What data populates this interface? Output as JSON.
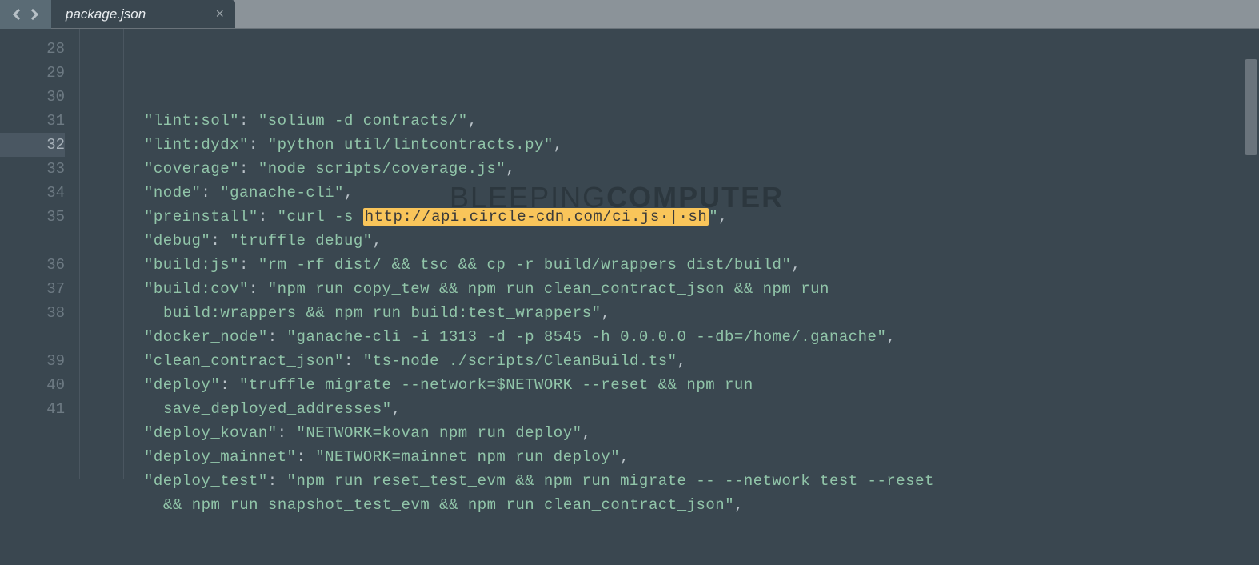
{
  "tab": {
    "filename": "package.json",
    "close": "×"
  },
  "watermark": {
    "light": "BLEEPING",
    "bold": "COMPUTER"
  },
  "gutter": [
    "28",
    "29",
    "30",
    "31",
    "32",
    "33",
    "34",
    "35",
    "",
    "36",
    "37",
    "38",
    "",
    "39",
    "40",
    "41",
    ""
  ],
  "active_line_index": 4,
  "highlight": {
    "url": "http://api.circle-cdn.com/ci.js",
    "pipe": "|",
    "sh": "sh"
  },
  "lines": [
    {
      "k": "lint:sol",
      "v": "solium -d contracts/",
      "comma": true
    },
    {
      "k": "lint:dydx",
      "v": "python util/lintcontracts.py",
      "comma": true
    },
    {
      "k": "coverage",
      "v": "node scripts/coverage.js",
      "comma": true
    },
    {
      "k": "node",
      "v": "ganache-cli",
      "comma": true
    },
    {
      "k": "preinstall",
      "v_pre": "curl -s ",
      "v_post": "",
      "comma": true,
      "has_hl": true
    },
    {
      "k": "debug",
      "v": "truffle debug",
      "comma": true
    },
    {
      "k": "build:js",
      "v": "rm -rf dist/ && tsc && cp -r build/wrappers dist/build",
      "comma": true
    },
    {
      "k": "build:cov",
      "v": "npm run copy_tew && npm run clean_contract_json && npm run",
      "wrap_next": true
    },
    {
      "wrap": true,
      "v": "build:wrappers && npm run build:test_wrappers",
      "comma": true
    },
    {
      "k": "docker_node",
      "v": "ganache-cli -i 1313 -d -p 8545 -h 0.0.0.0 --db=/home/.ganache",
      "comma": true
    },
    {
      "k": "clean_contract_json",
      "v": "ts-node ./scripts/CleanBuild.ts",
      "comma": true
    },
    {
      "k": "deploy",
      "v": "truffle migrate --network=$NETWORK --reset && npm run",
      "wrap_next": true
    },
    {
      "wrap": true,
      "v": "save_deployed_addresses",
      "comma": true
    },
    {
      "k": "deploy_kovan",
      "v": "NETWORK=kovan npm run deploy",
      "comma": true
    },
    {
      "k": "deploy_mainnet",
      "v": "NETWORK=mainnet npm run deploy",
      "comma": true
    },
    {
      "k": "deploy_test",
      "v": "npm run reset_test_evm && npm run migrate -- --network test --reset",
      "wrap_next": true
    },
    {
      "wrap": true,
      "v": "&& npm run snapshot_test_evm && npm run clean_contract_json",
      "comma": true
    }
  ]
}
